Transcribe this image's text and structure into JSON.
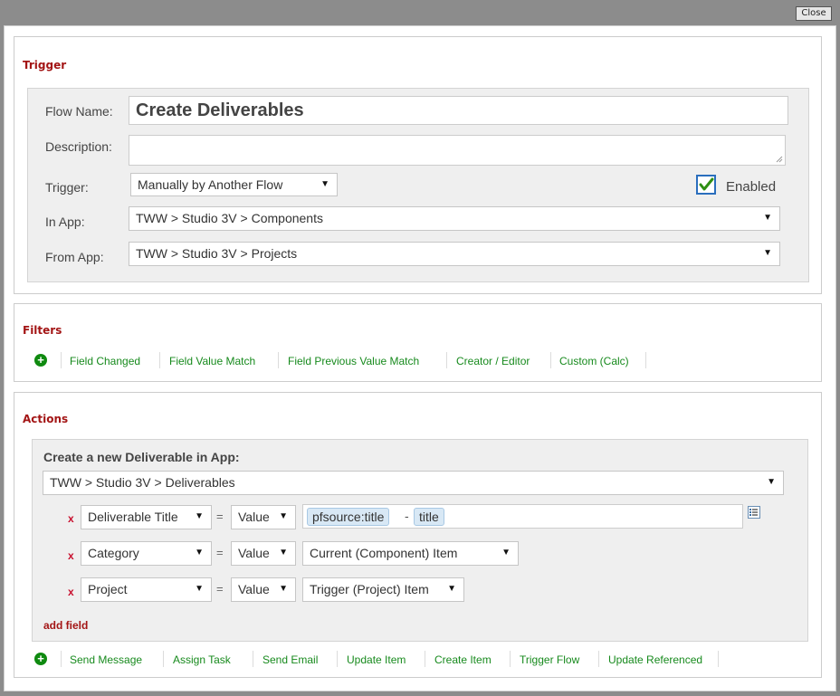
{
  "close_label": "Close",
  "trigger": {
    "section_title": "Trigger",
    "flow_name_label": "Flow Name:",
    "flow_name_value": "Create Deliverables",
    "description_label": "Description:",
    "description_value": "",
    "trigger_label": "Trigger:",
    "trigger_value": "Manually by Another Flow",
    "enabled_label": "Enabled",
    "enabled_checked": true,
    "in_app_label": "In App:",
    "in_app_value": "TWW > Studio 3V > Components",
    "from_app_label": "From App:",
    "from_app_value": "TWW > Studio 3V > Projects"
  },
  "filters": {
    "section_title": "Filters",
    "items": [
      "Field Changed",
      "Field Value Match",
      "Field Previous Value Match",
      "Creator / Editor",
      "Custom (Calc)"
    ]
  },
  "actions": {
    "section_title": "Actions",
    "create_heading": "Create a new Deliverable in App:",
    "app_value": "TWW > Studio 3V > Deliverables",
    "rows": [
      {
        "remove": "x",
        "field": "Deliverable Title",
        "op": "=",
        "mode": "Value",
        "tokens": [
          "pfsource:title",
          "title"
        ],
        "joiner": "-"
      },
      {
        "remove": "x",
        "field": "Category",
        "op": "=",
        "mode": "Value",
        "target": "Current (Component) Item"
      },
      {
        "remove": "x",
        "field": "Project",
        "op": "=",
        "mode": "Value",
        "target": "Trigger (Project) Item"
      }
    ],
    "add_field_label": "add field",
    "items": [
      "Send Message",
      "Assign Task",
      "Send Email",
      "Update Item",
      "Create Item",
      "Trigger Flow",
      "Update Referenced"
    ]
  },
  "icons": {
    "add": "plus-circle-icon",
    "dropdown": "triangle-down-icon",
    "checkbox": "checkmark-icon",
    "field_picker": "field-list-icon"
  },
  "colors": {
    "section_title": "#a31515",
    "link": "#178a1d",
    "remove": "#c8102e",
    "token_bg": "#d8e8f5"
  }
}
